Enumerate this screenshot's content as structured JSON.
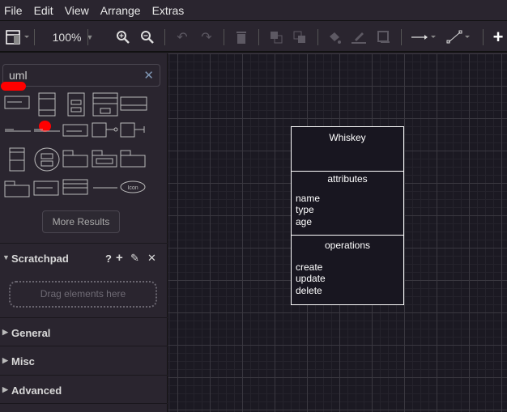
{
  "menu": [
    "File",
    "Edit",
    "View",
    "Arrange",
    "Extras"
  ],
  "toolbar": {
    "zoom": "100%",
    "icons": [
      "format-panel-icon",
      "zoom-in-icon",
      "zoom-out-icon",
      "undo-icon",
      "redo-icon",
      "delete-icon",
      "to-front-icon",
      "to-back-icon",
      "fill-color-icon",
      "line-color-icon",
      "shadow-icon",
      "connection-icon",
      "waypoints-icon",
      "insert-icon"
    ]
  },
  "sidebar": {
    "search": {
      "value": "uml"
    },
    "more_results": "More Results",
    "scratchpad": {
      "title": "Scratchpad",
      "help": "?",
      "drop_hint": "Drag elements here"
    },
    "panels": [
      "General",
      "Misc",
      "Advanced"
    ],
    "shapes_last_label": "Icon"
  },
  "diagram": {
    "class_name": "Whiskey",
    "attributes_title": "attributes",
    "attributes": [
      "name",
      "type",
      "age"
    ],
    "operations_title": "operations",
    "operations": [
      "create",
      "update",
      "delete"
    ]
  },
  "colors": {
    "background": "#2a252f",
    "canvas": "#1b1922",
    "accent_mark": "#ff0000"
  }
}
